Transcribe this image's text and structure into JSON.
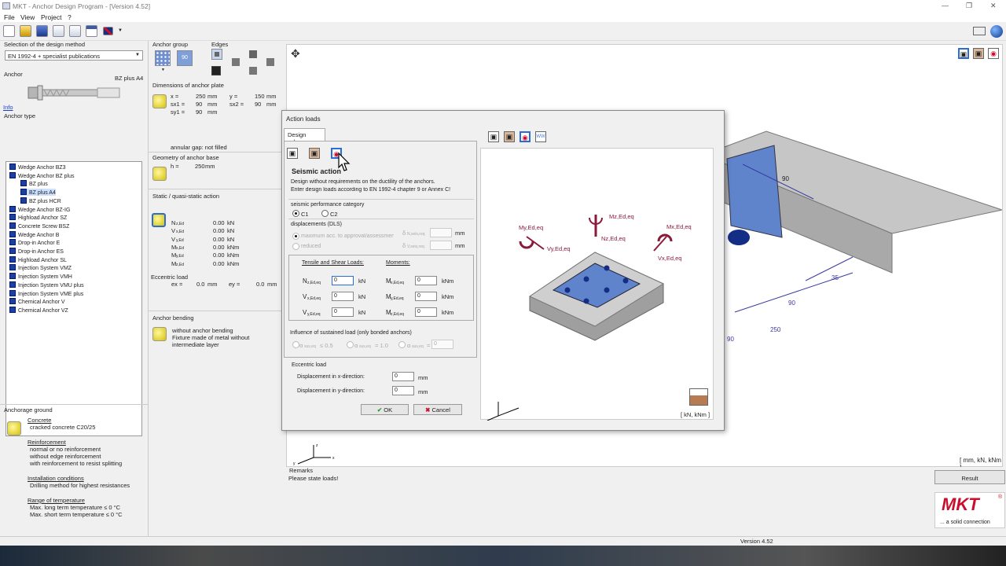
{
  "window": {
    "title": "MKT - Anchor Design Program - [Version 4.52]",
    "minimize": "—",
    "restore": "❐",
    "close": "✕"
  },
  "menu": [
    "File",
    "View",
    "Project",
    "?"
  ],
  "left": {
    "design_method_label": "Selection of the design method",
    "design_method_value": "EN 1992-4 + specialist publications",
    "anchor_label": "Anchor",
    "anchor_name": "BZ plus A4",
    "info_link": "Info",
    "anchor_type_label": "Anchor type",
    "anchor_types": [
      {
        "label": "Wedge Anchor BZ3",
        "indent": 0
      },
      {
        "label": "Wedge Anchor BZ plus",
        "indent": 0
      },
      {
        "label": "BZ plus",
        "indent": 1
      },
      {
        "label": "BZ plus A4",
        "indent": 1,
        "selected": true
      },
      {
        "label": "BZ plus HCR",
        "indent": 1
      },
      {
        "label": "Wedge Anchor BZ-IG",
        "indent": 0
      },
      {
        "label": "Highload Anchor SZ",
        "indent": 0
      },
      {
        "label": "Concrete Screw BSZ",
        "indent": 0
      },
      {
        "label": "Wedge Anchor B",
        "indent": 0
      },
      {
        "label": "Drop-in Anchor E",
        "indent": 0
      },
      {
        "label": "Drop-in Anchor ES",
        "indent": 0
      },
      {
        "label": "Highload Anchor SL",
        "indent": 0
      },
      {
        "label": "Injection System VMZ",
        "indent": 0
      },
      {
        "label": "Injection System VMH",
        "indent": 0
      },
      {
        "label": "Injection System VMU plus",
        "indent": 0
      },
      {
        "label": "Injection System VME plus",
        "indent": 0
      },
      {
        "label": "Chemical Anchor V",
        "indent": 0
      },
      {
        "label": "Chemical Anchor VZ",
        "indent": 0
      }
    ],
    "anchorage_ground_label": "Anchorage ground",
    "concrete_head": "Concrete",
    "concrete_value": "cracked concrete C20/25",
    "reinforcement_head": "Reinforcement",
    "reinforcement_lines": [
      "normal or no reinforcement",
      "without edge reinforcement",
      "with reinforcement to resist splitting"
    ],
    "installation_head": "Installation conditions",
    "installation_value": "Drilling method for highest resistances",
    "temperature_head": "Range of temperature",
    "temperature_lines": [
      "Max. long term temperature ≤ 0 °C",
      "Max. short term temperature ≤ 0 °C"
    ]
  },
  "mid": {
    "anchor_group_label": "Anchor group",
    "edges_label": "Edges",
    "anchor_plate_label": "Dimensions of anchor plate",
    "plate_rows": [
      {
        "k1": "x =",
        "v1": "250",
        "u1": "mm",
        "k2": "y =",
        "v2": "150",
        "u2": "mm"
      },
      {
        "k1": "sx1 =",
        "v1": "90",
        "u1": "mm",
        "k2": "sx2 =",
        "v2": "90",
        "u2": "mm"
      },
      {
        "k1": "sy1 =",
        "v1": "90",
        "u1": "mm",
        "k2": "",
        "v2": "",
        "u2": ""
      }
    ],
    "annular_gap": "annular gap: not filled",
    "anchor_base_label": "Geometry of anchor base",
    "base_h_key": "h =",
    "base_h_val": "250",
    "base_h_unit": "mm",
    "static_label": "Static / quasi-static action",
    "static_rows": [
      {
        "sym": "N",
        "sub": "z,Ed",
        "val": "0.00",
        "unit": "kN"
      },
      {
        "sym": "V",
        "sub": "x,Ed",
        "val": "0.00",
        "unit": "kN"
      },
      {
        "sym": "V",
        "sub": "y,Ed",
        "val": "0.00",
        "unit": "kN"
      },
      {
        "sym": "M",
        "sub": "x,Ed",
        "val": "0.00",
        "unit": "kNm"
      },
      {
        "sym": "M",
        "sub": "y,Ed",
        "val": "0.00",
        "unit": "kNm"
      },
      {
        "sym": "M",
        "sub": "z,Ed",
        "val": "0.00",
        "unit": "kNm"
      }
    ],
    "eccentric_label": "Eccentric load",
    "ex_key": "ex =",
    "ex_val": "0.0",
    "ex_unit": "mm",
    "ey_key": "ey =",
    "ey_val": "0.0",
    "ey_unit": "mm",
    "bending_label": "Anchor bending",
    "bending_line1": "without anchor bending",
    "bending_line2": "Fixture made of metal without intermediate layer"
  },
  "canvas": {
    "dims": [
      "90",
      "35",
      "90",
      "250",
      "90"
    ],
    "units": "[ mm, kN, kNm ]"
  },
  "remarks": {
    "label": "Remarks",
    "text": "Please state loads!"
  },
  "result_button": "Result",
  "logo": {
    "brand": "MKT",
    "reg": "®",
    "tagline": "... a solid connection"
  },
  "status": {
    "version": "Version 4.52"
  },
  "dialog": {
    "title": "Action loads",
    "tab": "Design values",
    "section_title": "Seismic action",
    "desc1": "Design without requirements on the ductility of the anchors.",
    "desc2": "Enter design loads according to EN 1992-4 chapter 9 or Annex C!",
    "perf_label": "seismic performance category",
    "perf_c1": "C1",
    "perf_c2": "C2",
    "displacement_label": "displacements (DLS)",
    "disp_max": "maximum acc. to approval/assessment",
    "disp_reduced": "reduced",
    "disp_unit": "mm",
    "dnreq_sym": "δ",
    "dnreq_sub": "N,seis,req",
    "dvreq_sym": "δ",
    "dvreq_sub": "V,seis,req",
    "tensile_head": "Tensile and Shear Loads:",
    "moments_head": "Moments:",
    "loads": [
      {
        "sym": "N",
        "sub": "z,Ed,eq",
        "val": "0",
        "unit": "kN",
        "msym": "M",
        "msub": "x,Ed,eq",
        "mval": "0",
        "munit": "kNm"
      },
      {
        "sym": "V",
        "sub": "x,Ed,eq",
        "val": "0",
        "unit": "kN",
        "msym": "M",
        "msub": "y,Ed,eq",
        "mval": "0",
        "munit": "kNm"
      },
      {
        "sym": "V",
        "sub": "y,Ed,eq",
        "val": "0",
        "unit": "kN",
        "msym": "M",
        "msub": "z,Ed,eq",
        "mval": "0",
        "munit": "kNm"
      }
    ],
    "sustained_label": "Influence of sustained load (only bonded anchors)",
    "alpha1": "α",
    "alpha1_sub": "sus,eq",
    "alpha1_tail": "≤ 0.5",
    "alpha2": "α",
    "alpha2_sub": "sus,eq",
    "alpha2_tail": "= 1.0",
    "alpha3": "α",
    "alpha3_sub": "sus,eq",
    "alpha3_tail": "=",
    "alpha3_val": "0",
    "eccentric_label": "Eccentric load",
    "disp_x_label": "Displacement in x-direction:",
    "disp_x_val": "0",
    "disp_y_label": "Displacement in y-direction:",
    "disp_y_val": "0",
    "mm": "mm",
    "ok": "OK",
    "cancel": "Cancel",
    "preview_labels": {
      "my": "My,Ed,eq",
      "vy": "Vy,Ed,eq",
      "mz": "Mz,Ed,eq",
      "nz": "Nz,Ed,eq",
      "mx": "Mx,Ed,eq",
      "vx": "Vx,Ed,eq"
    },
    "preview_units": "[ kN, kNm ]"
  },
  "colors": {
    "accent": "#8b1a3a",
    "plate": "#5a7ec8",
    "tree_icon": "#1f3fa0",
    "logo_red": "#c8102e"
  }
}
